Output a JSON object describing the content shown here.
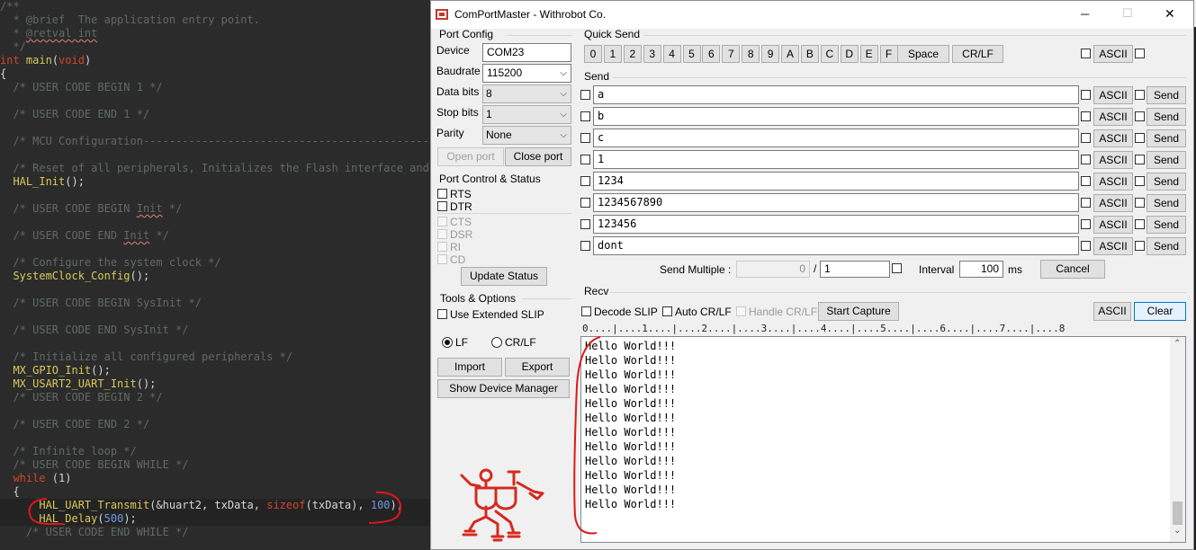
{
  "editor": {
    "lines": [
      {
        "segs": [
          {
            "c": "cm",
            "t": "/**"
          }
        ]
      },
      {
        "segs": [
          {
            "c": "cm",
            "t": "  * @brief  The application entry point."
          }
        ]
      },
      {
        "segs": [
          {
            "c": "cm",
            "t": "  * "
          },
          {
            "c": "cm sq",
            "t": "@retval int"
          }
        ]
      },
      {
        "segs": [
          {
            "c": "cm",
            "t": "  */"
          }
        ]
      },
      {
        "segs": [
          {
            "c": "kw",
            "t": "int "
          },
          {
            "c": "fn",
            "t": "main"
          },
          {
            "c": "tx",
            "t": "("
          },
          {
            "c": "kw",
            "t": "void"
          },
          {
            "c": "tx",
            "t": ")"
          }
        ]
      },
      {
        "segs": [
          {
            "c": "tx",
            "t": "{"
          }
        ]
      },
      {
        "segs": [
          {
            "c": "cm",
            "t": "  /* USER CODE BEGIN 1 */"
          }
        ]
      },
      {
        "segs": []
      },
      {
        "segs": [
          {
            "c": "cm",
            "t": "  /* USER CODE END 1 */"
          }
        ]
      },
      {
        "segs": []
      },
      {
        "segs": [
          {
            "c": "cm",
            "t": "  /* MCU Configuration--------------------------------------------------------"
          }
        ]
      },
      {
        "segs": []
      },
      {
        "segs": [
          {
            "c": "cm",
            "t": "  /* Reset of all peripherals, Initializes the Flash interface and the Systick. */"
          }
        ]
      },
      {
        "segs": [
          {
            "c": "tx",
            "t": "  "
          },
          {
            "c": "fn",
            "t": "HAL_Init"
          },
          {
            "c": "tx",
            "t": "();"
          }
        ]
      },
      {
        "segs": []
      },
      {
        "segs": [
          {
            "c": "cm",
            "t": "  /* USER CODE BEGIN "
          },
          {
            "c": "cm sq",
            "t": "Init"
          },
          {
            "c": "cm",
            "t": " */"
          }
        ]
      },
      {
        "segs": []
      },
      {
        "segs": [
          {
            "c": "cm",
            "t": "  /* USER CODE END "
          },
          {
            "c": "cm sq",
            "t": "Init"
          },
          {
            "c": "cm",
            "t": " */"
          }
        ]
      },
      {
        "segs": []
      },
      {
        "segs": [
          {
            "c": "cm",
            "t": "  /* Configure the system clock */"
          }
        ]
      },
      {
        "segs": [
          {
            "c": "tx",
            "t": "  "
          },
          {
            "c": "fn",
            "t": "SystemClock_Config"
          },
          {
            "c": "tx",
            "t": "();"
          }
        ]
      },
      {
        "segs": []
      },
      {
        "segs": [
          {
            "c": "cm",
            "t": "  /* USER CODE BEGIN SysInit */"
          }
        ]
      },
      {
        "segs": []
      },
      {
        "segs": [
          {
            "c": "cm",
            "t": "  /* USER CODE END SysInit */"
          }
        ]
      },
      {
        "segs": []
      },
      {
        "segs": [
          {
            "c": "cm",
            "t": "  /* Initialize all configured peripherals */"
          }
        ]
      },
      {
        "segs": [
          {
            "c": "tx",
            "t": "  "
          },
          {
            "c": "fn",
            "t": "MX_GPIO_Init"
          },
          {
            "c": "tx",
            "t": "();"
          }
        ]
      },
      {
        "segs": [
          {
            "c": "tx",
            "t": "  "
          },
          {
            "c": "fn",
            "t": "MX_USART2_UART_Init"
          },
          {
            "c": "tx",
            "t": "();"
          }
        ]
      },
      {
        "segs": [
          {
            "c": "cm",
            "t": "  /* USER CODE BEGIN 2 */"
          }
        ]
      },
      {
        "segs": []
      },
      {
        "segs": [
          {
            "c": "cm",
            "t": "  /* USER CODE END 2 */"
          }
        ]
      },
      {
        "segs": []
      },
      {
        "segs": [
          {
            "c": "cm",
            "t": "  /* Infinite loop */"
          }
        ]
      },
      {
        "segs": [
          {
            "c": "cm",
            "t": "  /* USER CODE BEGIN WHILE */"
          }
        ]
      },
      {
        "segs": [
          {
            "c": "tx",
            "t": "  "
          },
          {
            "c": "kw",
            "t": "while"
          },
          {
            "c": "tx",
            "t": " (1)"
          }
        ]
      },
      {
        "segs": [
          {
            "c": "tx",
            "t": "  {"
          }
        ]
      },
      {
        "segs": [
          {
            "c": "tx",
            "t": "      "
          },
          {
            "c": "fn",
            "t": "HAL_UART_Transmit"
          },
          {
            "c": "tx",
            "t": "(&huart2, txData, "
          },
          {
            "c": "kw",
            "t": "sizeof"
          },
          {
            "c": "tx",
            "t": "(txData), "
          },
          {
            "c": "nm",
            "t": "100"
          },
          {
            "c": "tx",
            "t": ");"
          }
        ]
      },
      {
        "segs": [
          {
            "c": "tx",
            "t": "      "
          },
          {
            "c": "fn",
            "t": "HAL_Delay"
          },
          {
            "c": "tx",
            "t": "("
          },
          {
            "c": "nm",
            "t": "500"
          },
          {
            "c": "tx",
            "t": ");"
          }
        ]
      },
      {
        "segs": [
          {
            "c": "cm",
            "t": "    /* USER CODE END WHILE */"
          }
        ]
      }
    ]
  },
  "window": {
    "title": "ComPortMaster - Withrobot Co.",
    "controls": {
      "minimize": "─",
      "maximize": "☐",
      "close": "✕"
    }
  },
  "port_config": {
    "title": "Port Config",
    "device_label": "Device",
    "device_value": "COM23",
    "baudrate_label": "Baudrate",
    "baudrate_value": "115200",
    "databits_label": "Data bits",
    "databits_value": "8",
    "stopbits_label": "Stop bits",
    "stopbits_value": "1",
    "parity_label": "Parity",
    "parity_value": "None",
    "open_port": "Open port",
    "close_port": "Close port"
  },
  "port_control": {
    "title": "Port Control & Status",
    "rts": "RTS",
    "dtr": "DTR",
    "cts": "CTS",
    "dsr": "DSR",
    "ri": "RI",
    "cd": "CD",
    "update_status": "Update Status"
  },
  "tools": {
    "title": "Tools & Options",
    "extended_slip": "Use Extended SLIP",
    "lf": "LF",
    "crlf": "CR/LF",
    "import": "Import",
    "export": "Export",
    "device_manager": "Show Device Manager"
  },
  "quick_send": {
    "title": "Quick Send",
    "keys": [
      "0",
      "1",
      "2",
      "3",
      "4",
      "5",
      "6",
      "7",
      "8",
      "9",
      "A",
      "B",
      "C",
      "D",
      "E",
      "F"
    ],
    "space": "Space",
    "crlf": "CR/LF",
    "ascii": "ASCII"
  },
  "send": {
    "title": "Send",
    "ascii": "ASCII",
    "send": "Send",
    "rows": [
      "a",
      "b",
      "c",
      "1",
      "1234",
      "1234567890",
      "123456",
      "dont"
    ],
    "multiple_label": "Send Multiple :",
    "multiple_count": "0",
    "multiple_sep": "/",
    "multiple_total": "1",
    "interval_label": "Interval",
    "interval_value": "100",
    "interval_unit": "ms",
    "cancel": "Cancel"
  },
  "recv": {
    "title": "Recv",
    "decode_slip": "Decode SLIP",
    "auto_crlf": "Auto CR/LF",
    "handle_crlf": "Handle CR/LF",
    "start_capture": "Start Capture",
    "ascii": "ASCII",
    "clear": "Clear",
    "ruler": "0....|....1....|....2....|....3....|....4....|....5....|....6....|....7....|....8",
    "lines": [
      "Hello World!!!",
      "Hello World!!!",
      "Hello World!!!",
      "Hello World!!!",
      "Hello World!!!",
      "Hello World!!!",
      "Hello World!!!",
      "Hello World!!!",
      "Hello World!!!",
      "Hello World!!!",
      "Hello World!!!",
      "Hello World!!!"
    ]
  },
  "colors": {
    "accent": "#0078d7",
    "annotation": "#e01818",
    "logo": "#d42a1e"
  }
}
